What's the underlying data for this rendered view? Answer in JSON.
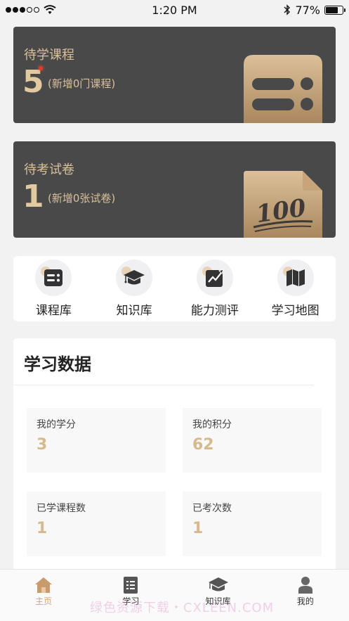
{
  "status_bar": {
    "time": "1:20 PM",
    "battery": "77%",
    "battery_level": 0.77,
    "signal_bars_filled": 3,
    "signal_bars_total": 5
  },
  "pending_courses": {
    "title": "待学课程",
    "count": "5",
    "note": "(新增0门课程)"
  },
  "pending_exams": {
    "title": "待考试卷",
    "count": "1",
    "note": "(新增0张试卷)"
  },
  "quick_nav": [
    {
      "label": "课程库",
      "icon": "course-library-icon"
    },
    {
      "label": "知识库",
      "icon": "graduation-cap-icon"
    },
    {
      "label": "能力测评",
      "icon": "trend-chart-icon"
    },
    {
      "label": "学习地图",
      "icon": "map-icon"
    }
  ],
  "learning_data": {
    "title": "学习数据",
    "stats": [
      {
        "label": "我的学分",
        "value": "3"
      },
      {
        "label": "我的积分",
        "value": "62"
      },
      {
        "label": "已学课程数",
        "value": "1"
      },
      {
        "label": "已考次数",
        "value": "1"
      }
    ]
  },
  "tabbar": [
    {
      "label": "主页",
      "icon": "home-icon",
      "active": true
    },
    {
      "label": "学习",
      "icon": "study-book-icon",
      "active": false
    },
    {
      "label": "知识库",
      "icon": "graduation-cap-icon",
      "active": false
    },
    {
      "label": "我的",
      "icon": "person-icon",
      "active": false
    }
  ],
  "watermark": "绿色资源下载・CXLEEN.COM",
  "colors": {
    "accent": "#d6b98c",
    "card_bg": "#4a4949",
    "active_tab": "#d2a678"
  }
}
